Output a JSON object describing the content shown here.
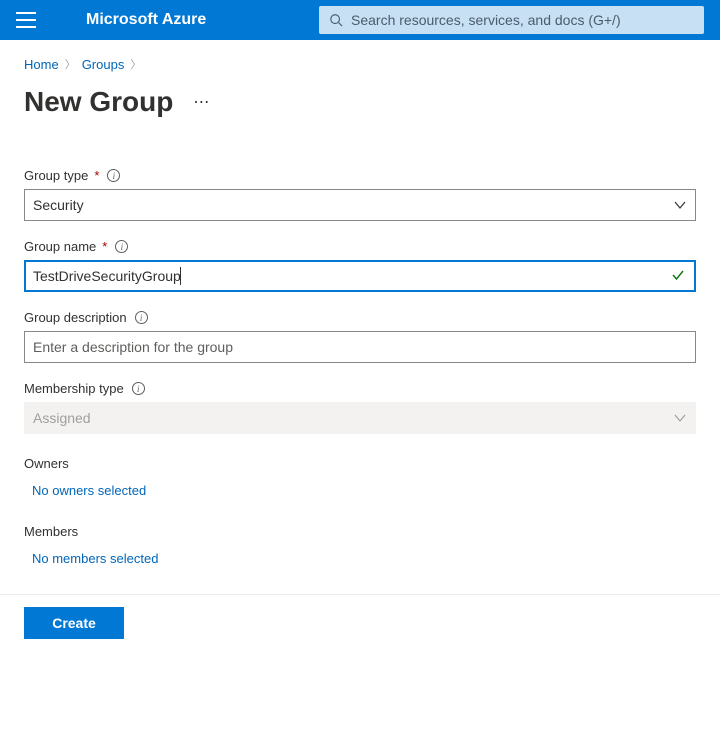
{
  "header": {
    "brand": "Microsoft Azure",
    "search_placeholder": "Search resources, services, and docs (G+/)"
  },
  "breadcrumb": {
    "home": "Home",
    "groups": "Groups"
  },
  "page": {
    "title": "New Group"
  },
  "fields": {
    "group_type": {
      "label": "Group type",
      "value": "Security"
    },
    "group_name": {
      "label": "Group name",
      "value": "TestDriveSecurityGroup"
    },
    "group_description": {
      "label": "Group description",
      "placeholder": "Enter a description for the group",
      "value": ""
    },
    "membership_type": {
      "label": "Membership type",
      "value": "Assigned"
    }
  },
  "owners": {
    "label": "Owners",
    "link": "No owners selected"
  },
  "members": {
    "label": "Members",
    "link": "No members selected"
  },
  "footer": {
    "create": "Create"
  }
}
